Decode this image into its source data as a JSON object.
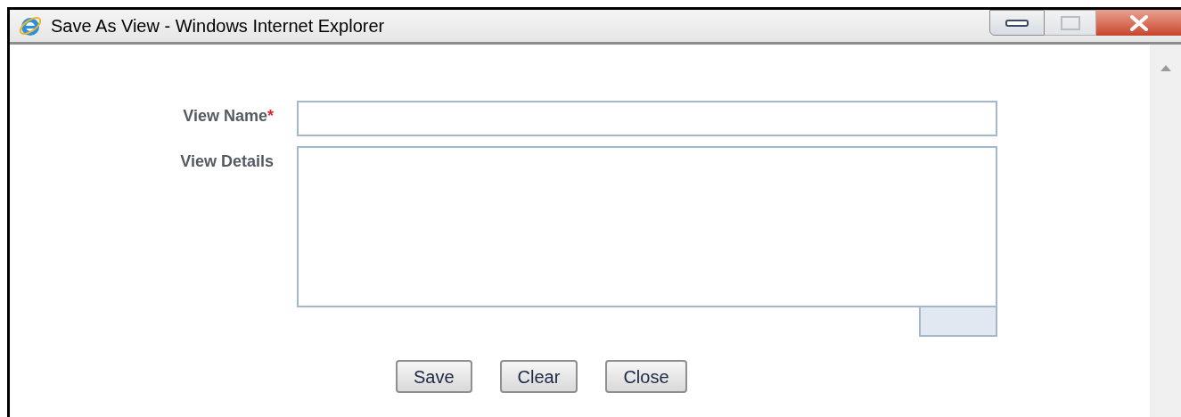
{
  "window": {
    "title": "Save As View - Windows Internet Explorer"
  },
  "form": {
    "fields": [
      {
        "kind": "input",
        "label": "View Name",
        "required_mark": "*"
      },
      {
        "kind": "textarea",
        "label": "View Details"
      }
    ]
  },
  "buttons": [
    "Save",
    "Clear",
    "Close"
  ]
}
